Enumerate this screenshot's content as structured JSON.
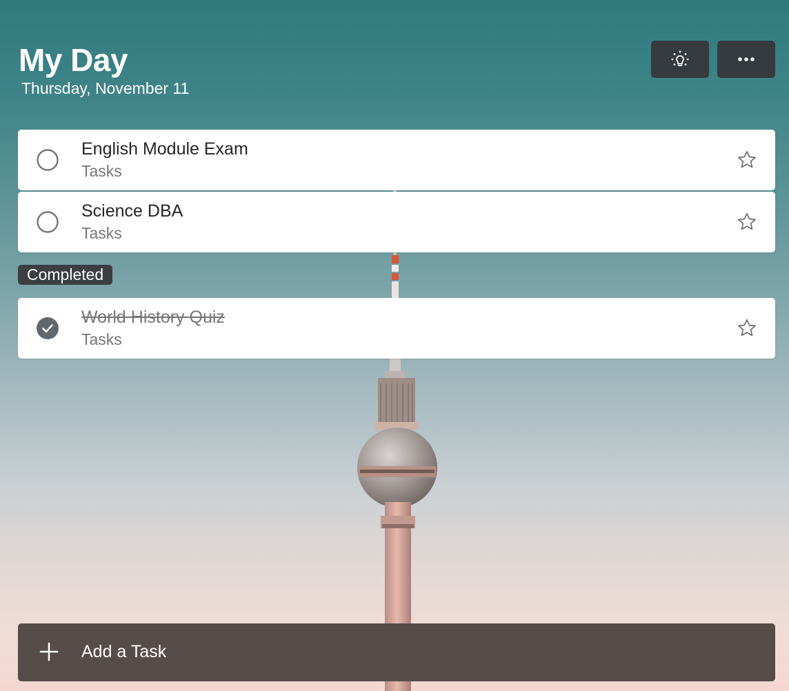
{
  "header": {
    "title": "My Day",
    "date": "Thursday, November 11"
  },
  "toolbar": {
    "suggestions_icon": "lightbulb-icon",
    "more_icon": "more-icon"
  },
  "tasks": [
    {
      "name": "English Module Exam",
      "list": "Tasks",
      "completed": false,
      "starred": false
    },
    {
      "name": "Science DBA",
      "list": "Tasks",
      "completed": false,
      "starred": false
    }
  ],
  "completed_section": {
    "label": "Completed",
    "tasks": [
      {
        "name": "World History Quiz",
        "list": "Tasks",
        "completed": true,
        "starred": false
      }
    ]
  },
  "add_task": {
    "label": "Add a Task"
  },
  "colors": {
    "button_bg": "#353b3f",
    "add_task_bg": "#564d4a",
    "check_done": "#60686d"
  }
}
